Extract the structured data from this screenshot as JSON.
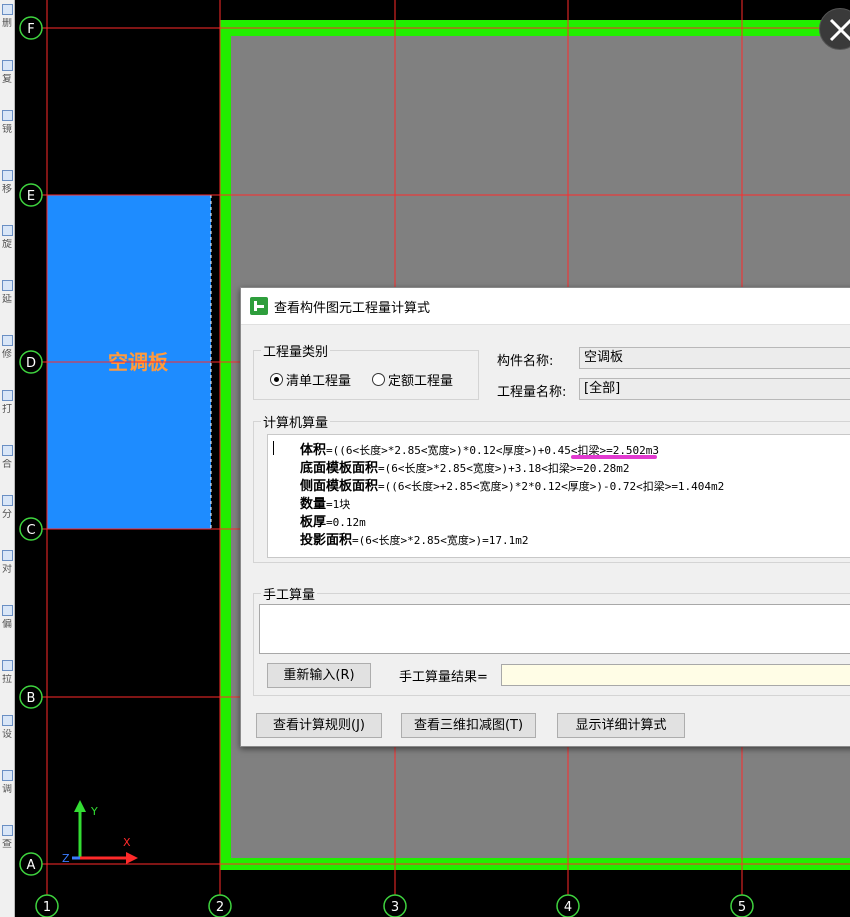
{
  "canvas": {
    "row_labels": [
      "F",
      "E",
      "D",
      "C",
      "B",
      "A"
    ],
    "col_labels": [
      "1",
      "2",
      "3",
      "4",
      "5"
    ],
    "slab_label": "空调板",
    "ucs": {
      "x": "X",
      "y": "Y",
      "z": "Z"
    },
    "colors": {
      "grid": "#ff2a2a",
      "slab": "#1e8cff",
      "slab_label": "#ff9a3c",
      "wall": "#22ee00",
      "floor": "#808080"
    }
  },
  "toolbar": {
    "items": [
      "删",
      "复",
      "镜",
      "移",
      "旋",
      "延",
      "修",
      "打",
      "合",
      "分",
      "对",
      "偏",
      "拉",
      "设",
      "调",
      "查"
    ]
  },
  "dialog": {
    "title": "查看构件图元工程量计算式",
    "quantity_type": {
      "label": "工程量类别",
      "options": [
        {
          "label": "清单工程量",
          "checked": true
        },
        {
          "label": "定额工程量",
          "checked": false
        }
      ]
    },
    "component_name": {
      "label": "构件名称:",
      "value": "空调板"
    },
    "quantity_name": {
      "label": "工程量名称:",
      "value": "[全部]"
    },
    "computer_calc": {
      "label": "计算机算量",
      "lines": [
        {
          "name": "体积",
          "formula": "=((6<长度>*2.85<宽度>)*0.12<厚度>)+0.45<扣梁>=2.502m3"
        },
        {
          "name": "底面模板面积",
          "formula": "=(6<长度>*2.85<宽度>)+3.18<扣梁>=20.28m2"
        },
        {
          "name": "侧面模板面积",
          "formula": "=((6<长度>+2.85<宽度>)*2*0.12<厚度>)-0.72<扣梁>=1.404m2"
        },
        {
          "name": "数量",
          "formula": "=1块"
        },
        {
          "name": "板厚",
          "formula": "=0.12m"
        },
        {
          "name": "投影面积",
          "formula": "=(6<长度>*2.85<宽度>)=17.1m2"
        }
      ]
    },
    "manual_calc": {
      "label": "手工算量",
      "reenter_button": "重新输入(R)",
      "result_label": "手工算量结果=",
      "result_value": ""
    },
    "buttons": {
      "rules": "查看计算规则(J)",
      "view_3d": "查看三维扣减图(T)",
      "details": "显示详细计算式"
    }
  }
}
